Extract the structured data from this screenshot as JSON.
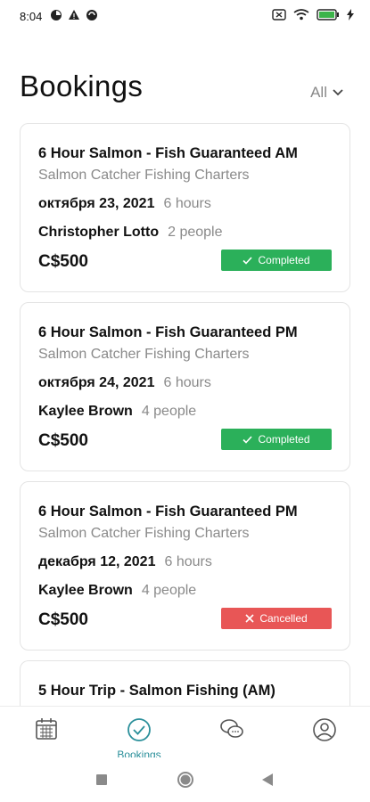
{
  "status_bar": {
    "time": "8:04"
  },
  "header": {
    "title": "Bookings",
    "filter_label": "All"
  },
  "bookings": [
    {
      "title": "6 Hour Salmon - Fish Guaranteed AM",
      "operator": "Salmon Catcher Fishing Charters",
      "date": "октября 23, 2021",
      "duration": "6 hours",
      "customer": "Christopher Lotto",
      "party": "2 people",
      "price": "C$500",
      "status": "Completed"
    },
    {
      "title": "6 Hour Salmon - Fish Guaranteed PM",
      "operator": "Salmon Catcher Fishing Charters",
      "date": "октября 24, 2021",
      "duration": "6 hours",
      "customer": "Kaylee Brown",
      "party": "4 people",
      "price": "C$500",
      "status": "Completed"
    },
    {
      "title": "6 Hour Salmon - Fish Guaranteed PM",
      "operator": "Salmon Catcher Fishing Charters",
      "date": "декабря 12, 2021",
      "duration": "6 hours",
      "customer": "Kaylee Brown",
      "party": "4 people",
      "price": "C$500",
      "status": "Cancelled"
    },
    {
      "title": "5 Hour Trip - Salmon Fishing (AM)"
    }
  ],
  "bottom_nav": {
    "items": [
      {
        "icon": "calendar-icon",
        "label": ""
      },
      {
        "icon": "check-circle-icon",
        "label": "Bookings"
      },
      {
        "icon": "chat-icon",
        "label": ""
      },
      {
        "icon": "profile-icon",
        "label": ""
      }
    ],
    "active_color": "#2a8f9a"
  },
  "colors": {
    "completed": "#2bb05a",
    "cancelled": "#e85656"
  }
}
